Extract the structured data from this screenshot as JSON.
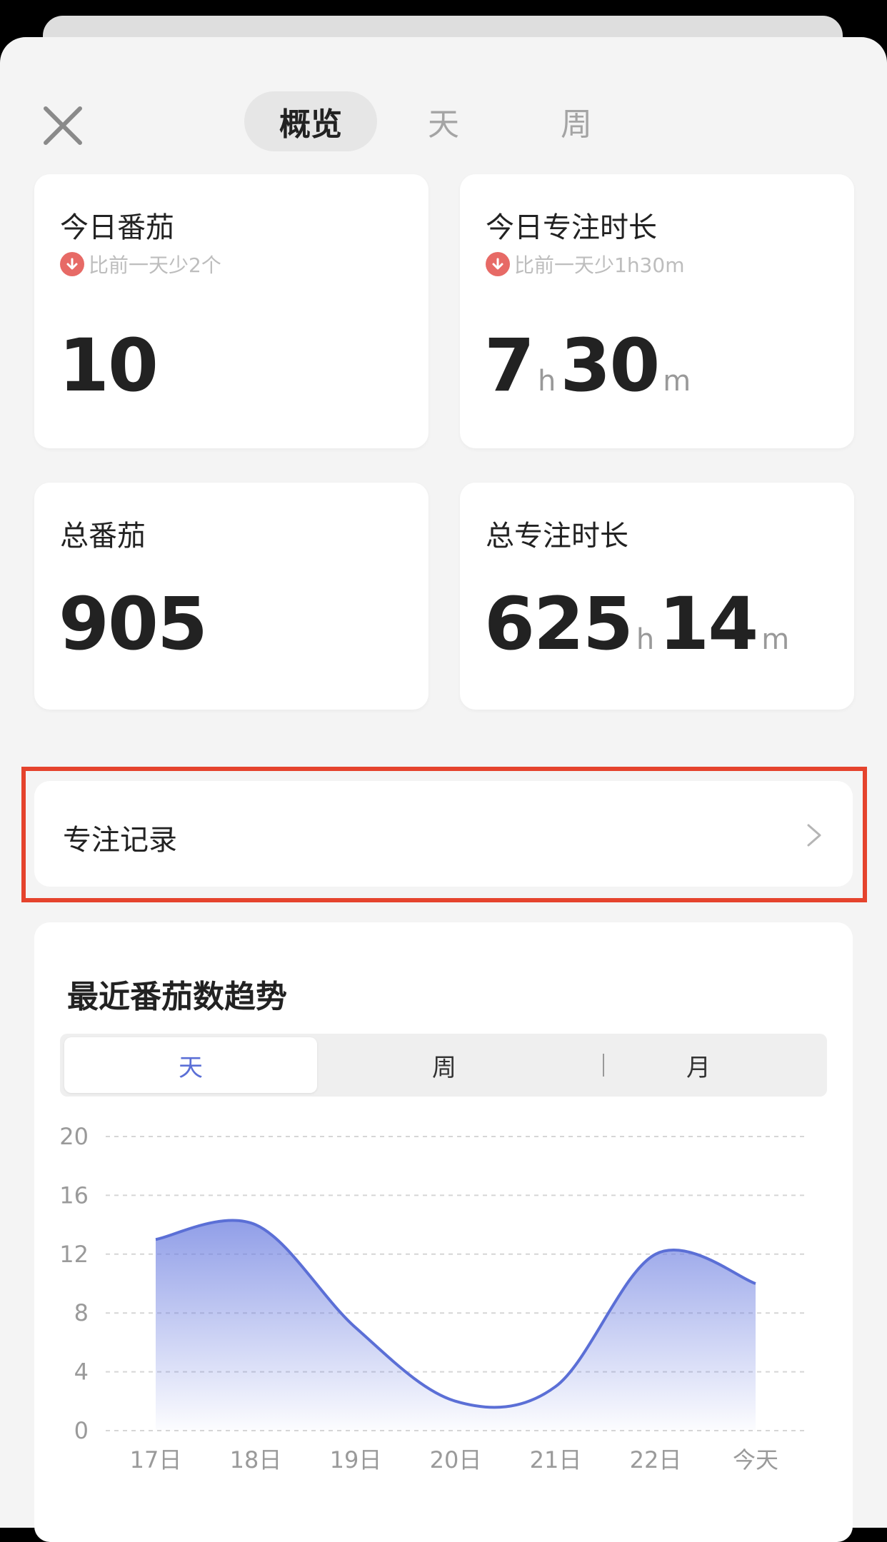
{
  "header": {
    "tabs": [
      {
        "label": "概览",
        "active": true
      },
      {
        "label": "天",
        "active": false
      },
      {
        "label": "周",
        "active": false
      }
    ]
  },
  "stats": {
    "today_tomato": {
      "title": "今日番茄",
      "delta": "比前一天少2个",
      "value": "10"
    },
    "today_focus": {
      "title": "今日专注时长",
      "delta": "比前一天少1h30m",
      "hours": "7",
      "hours_unit": "h",
      "minutes": "30",
      "minutes_unit": "m"
    },
    "total_tomato": {
      "title": "总番茄",
      "value": "905"
    },
    "total_focus": {
      "title": "总专注时长",
      "hours": "625",
      "hours_unit": "h",
      "minutes": "14",
      "minutes_unit": "m"
    }
  },
  "record": {
    "label": "专注记录"
  },
  "trend": {
    "title": "最近番茄数趋势",
    "range_tabs": [
      {
        "label": "天",
        "active": true
      },
      {
        "label": "周",
        "active": false
      },
      {
        "label": "月",
        "active": false
      }
    ]
  },
  "colors": {
    "accent": "#5b6fd6",
    "delta_down": "#e76a66",
    "highlight": "#e5432d"
  },
  "chart_data": {
    "type": "area",
    "categories": [
      "17日",
      "18日",
      "19日",
      "20日",
      "21日",
      "22日",
      "今天"
    ],
    "values": [
      13,
      14,
      7,
      2,
      3,
      12,
      10
    ],
    "yticks": [
      0,
      4,
      8,
      12,
      16,
      20
    ],
    "ylim": [
      0,
      20
    ],
    "grid": true
  }
}
